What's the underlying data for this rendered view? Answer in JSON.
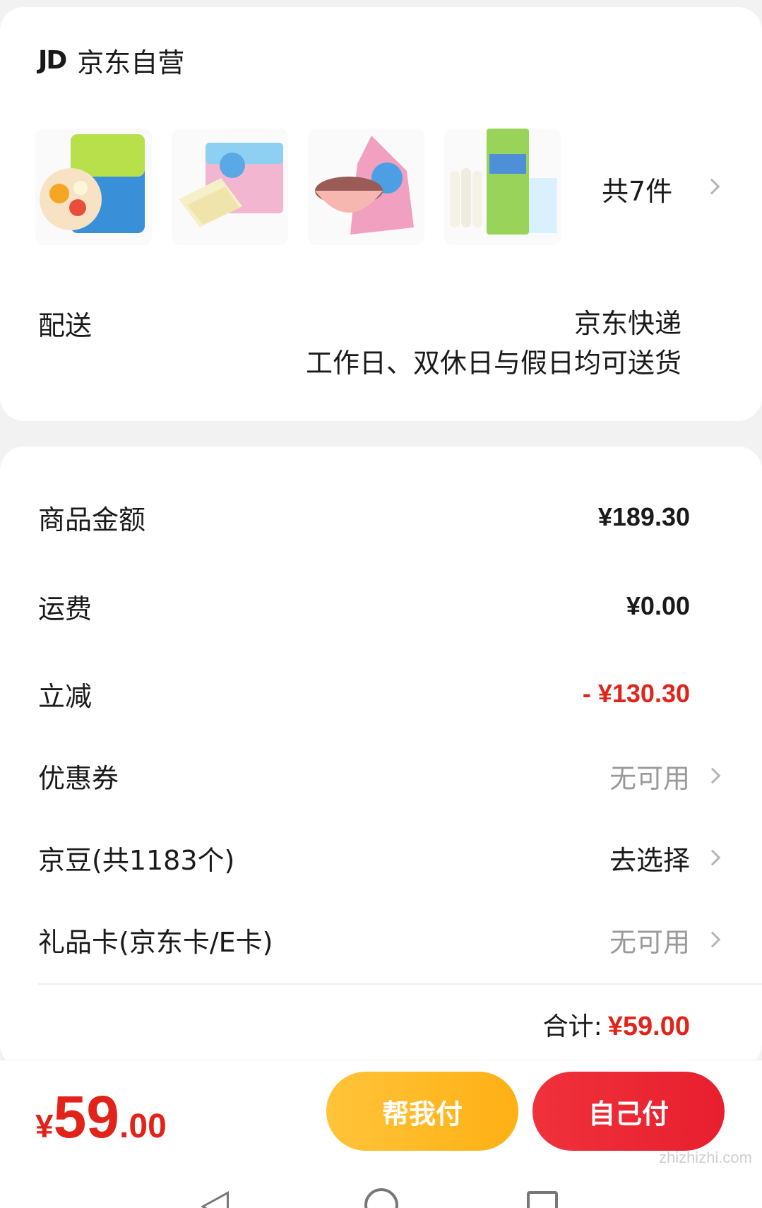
{
  "shop": {
    "logo": "JD",
    "name": "京东自营",
    "products": [
      "freeze-dried fruit pouch",
      "rice cracker box",
      "fruit puree pouch",
      "fish sausage pack"
    ],
    "item_count": "共7件",
    "delivery_label": "配送",
    "delivery_method": "京东快递",
    "delivery_time": "工作日、双休日与假日均可送货"
  },
  "summary": {
    "goods_label": "商品金额",
    "goods_value": "¥189.30",
    "shipping_label": "运费",
    "shipping_value": "¥0.00",
    "discount_label": "立减",
    "discount_value": "- ¥130.30",
    "coupon_label": "优惠券",
    "coupon_value": "无可用",
    "beans_label": "京豆(共1183个)",
    "beans_value": "去选择",
    "giftcard_label": "礼品卡(京东卡/E卡)",
    "giftcard_value": "无可用",
    "total_label": "合计:",
    "total_value": "¥59.00"
  },
  "bottom": {
    "currency": "¥",
    "price_int": "59",
    "price_dec": ".00",
    "help_pay": "帮我付",
    "self_pay": "自己付"
  },
  "watermark": "zhizhizhi.com",
  "colors": {
    "accent_red": "#e2231a",
    "button_yellow": "#ffb014",
    "button_red": "#e81f2e"
  }
}
